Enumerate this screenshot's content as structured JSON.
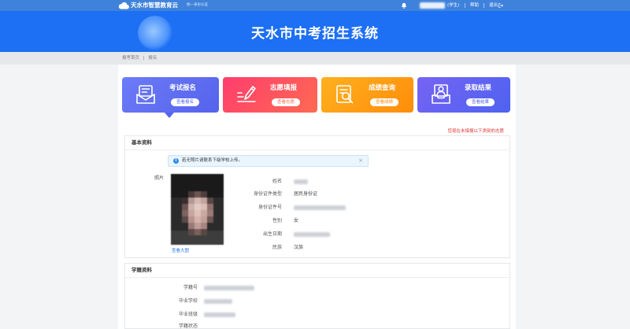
{
  "colors": {
    "topbar": "#3f82db",
    "banner": "#1d6ff3",
    "link": "#2a7be4",
    "notice_red": "#e0332f"
  },
  "topbar": {
    "brand": "天水市智慧教育云",
    "brand_sub": "统一身份认证",
    "role": "(学生)",
    "help": "帮助",
    "logout": "退出",
    "icons": {
      "logo": "cloud-icon",
      "notify": "bell-icon",
      "logout": "logout-icon"
    }
  },
  "banner": {
    "title": "天水市中考招生系统"
  },
  "breadcrumb": {
    "home": "报考首页",
    "separator": "|",
    "current": "报名"
  },
  "cards": [
    {
      "title": "考试报名",
      "button": "查看报名",
      "icon": "envelope-form-icon",
      "color_from": "#6c7bf7",
      "color_to": "#5563ec",
      "selected": true
    },
    {
      "title": "志愿填报",
      "button": "查看志愿",
      "icon": "pen-icon",
      "color_from": "#ff3d6e",
      "color_to": "#ff6a52"
    },
    {
      "title": "成绩查询",
      "button": "查看成绩",
      "icon": "search-document-icon",
      "color_from": "#ffb01f",
      "color_to": "#ff8d0a"
    },
    {
      "title": "录取结果",
      "button": "查看结果",
      "icon": "inbox-user-icon",
      "color_from": "#7763f3",
      "color_to": "#4d63f0"
    }
  ],
  "notice": "您现在未填报以下类别的志愿",
  "basic": {
    "title": "基本资料",
    "alert": "若无照片请联系下级学校上传。",
    "close": "×",
    "photo_label": "照片",
    "photo_link": "查看大图",
    "fields": [
      {
        "label": "姓名"
      },
      {
        "label": "身份证件类型",
        "value": "居民身份证"
      },
      {
        "label": "身份证件号"
      },
      {
        "label": "性别",
        "value": "女"
      },
      {
        "label": "出生日期"
      },
      {
        "label": "民族",
        "value": "汉族"
      }
    ]
  },
  "school": {
    "title": "学籍资料",
    "fields": [
      {
        "label": "学籍号"
      },
      {
        "label": "毕业学校"
      },
      {
        "label": "毕业班级"
      },
      {
        "label": "学籍状态"
      }
    ]
  }
}
